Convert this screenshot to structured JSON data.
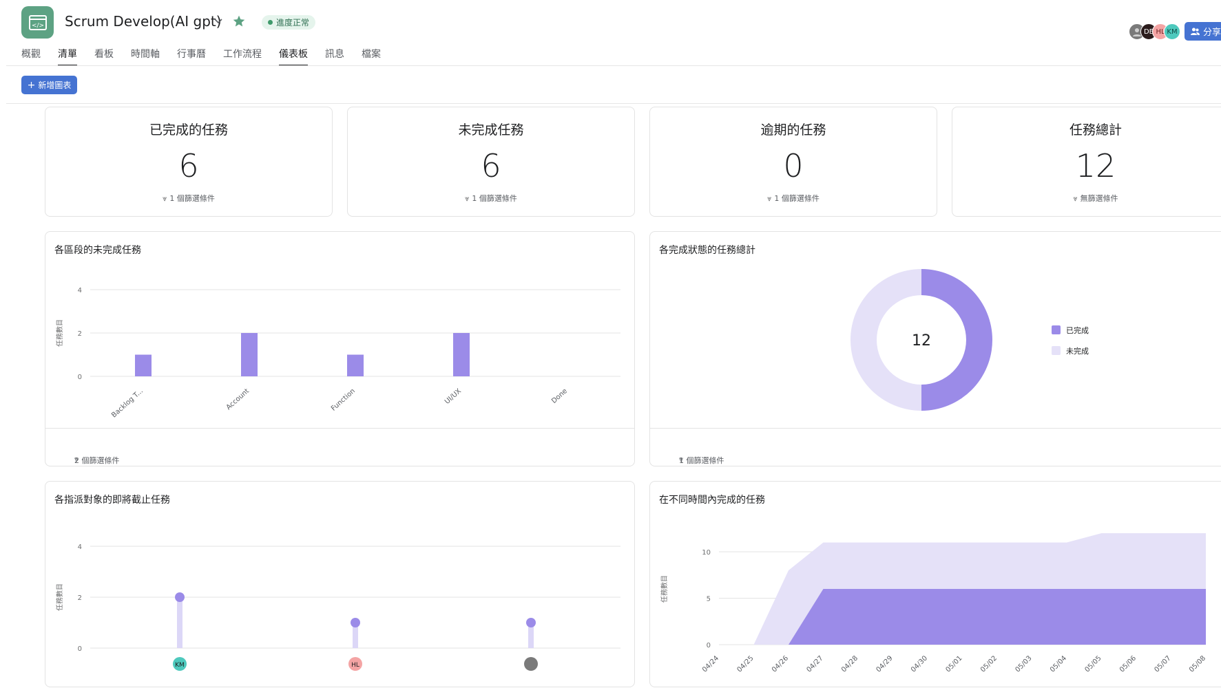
{
  "header": {
    "project_title": "Scrum Develop(AI gpt)",
    "status_label": "進度正常",
    "share_label": "分享",
    "app_icon_glyph": "</>",
    "colors": {
      "app_icon": "#5da283",
      "star": "#5da283",
      "primary": "#4573d2"
    }
  },
  "avatars": [
    {
      "label": "",
      "bg": "#7a7a7a"
    },
    {
      "label": "DE",
      "bg": "#2b1c1c"
    },
    {
      "label": "HL",
      "bg": "#f4a4a4"
    },
    {
      "label": "KM",
      "bg": "#4ec9bd"
    }
  ],
  "tabs": [
    {
      "label": "概觀",
      "active": false
    },
    {
      "label": "清單",
      "active": true
    },
    {
      "label": "看板",
      "active": false
    },
    {
      "label": "時間軸",
      "active": false
    },
    {
      "label": "行事曆",
      "active": false
    },
    {
      "label": "工作流程",
      "active": false
    },
    {
      "label": "儀表板",
      "active": true
    },
    {
      "label": "訊息",
      "active": false
    },
    {
      "label": "檔案",
      "active": false
    }
  ],
  "toolbar": {
    "add_chart_label": "新增圖表"
  },
  "number_cards": [
    {
      "title": "已完成的任務",
      "value": "6",
      "filter": "1 個篩選條件"
    },
    {
      "title": "未完成任務",
      "value": "6",
      "filter": "1 個篩選條件"
    },
    {
      "title": "逾期的任務",
      "value": "0",
      "filter": "1 個篩選條件"
    },
    {
      "title": "任務總計",
      "value": "12",
      "filter": "無篩選條件"
    }
  ],
  "charts": {
    "section_bar": {
      "title": "各區段的未完成任務",
      "filter": "2 個篩選條件"
    },
    "status_donut": {
      "title": "各完成狀態的任務總計",
      "filter": "1 個篩選條件"
    },
    "assignee_lollipop": {
      "title": "各指派對象的即將截止任務"
    },
    "completion_area": {
      "title": "在不同時間內完成的任務"
    }
  },
  "chart_data": [
    {
      "type": "bar",
      "ylabel": "任務數目",
      "categories": [
        "Backlog T...",
        "Account",
        "Function",
        "UI/UX",
        "Done"
      ],
      "values": [
        1,
        2,
        1,
        2,
        0
      ],
      "ylim": [
        0,
        4
      ],
      "yticks": [
        0,
        2,
        4
      ],
      "color": "#9b8be8",
      "grid": true
    },
    {
      "type": "pie",
      "total": "12",
      "labels": [
        "已完成",
        "未完成"
      ],
      "values": [
        6,
        6
      ],
      "colors": [
        "#9b8be8",
        "#e5e1f8"
      ],
      "legend": "right"
    },
    {
      "type": "scatter",
      "ylabel": "任務數目",
      "categories": [
        "KM",
        "HL",
        ""
      ],
      "category_colors": [
        "#4ec9bd",
        "#f4a4a4",
        "#7a7a7a"
      ],
      "values": [
        2,
        1,
        1
      ],
      "ylim": [
        0,
        4
      ],
      "yticks": [
        0,
        2,
        4
      ],
      "color": "#9b8be8",
      "stem_color": "#dcd7f7"
    },
    {
      "type": "area",
      "ylabel": "任務數目",
      "x": [
        "04/24",
        "04/25",
        "04/26",
        "04/27",
        "04/28",
        "04/29",
        "04/30",
        "05/01",
        "05/02",
        "05/03",
        "05/04",
        "05/05",
        "05/06",
        "05/07",
        "05/08"
      ],
      "series": [
        {
          "values": [
            0,
            0,
            8,
            11,
            11,
            11,
            11,
            11,
            11,
            11,
            11,
            12,
            12,
            12,
            12
          ],
          "color": "#e5e1f8"
        },
        {
          "values": [
            0,
            0,
            0,
            6,
            6,
            6,
            6,
            6,
            6,
            6,
            6,
            6,
            6,
            6,
            6
          ],
          "color": "#9b8be8"
        }
      ],
      "ylim": [
        0,
        12
      ],
      "yticks": [
        0,
        5,
        10
      ],
      "grid": true
    }
  ]
}
